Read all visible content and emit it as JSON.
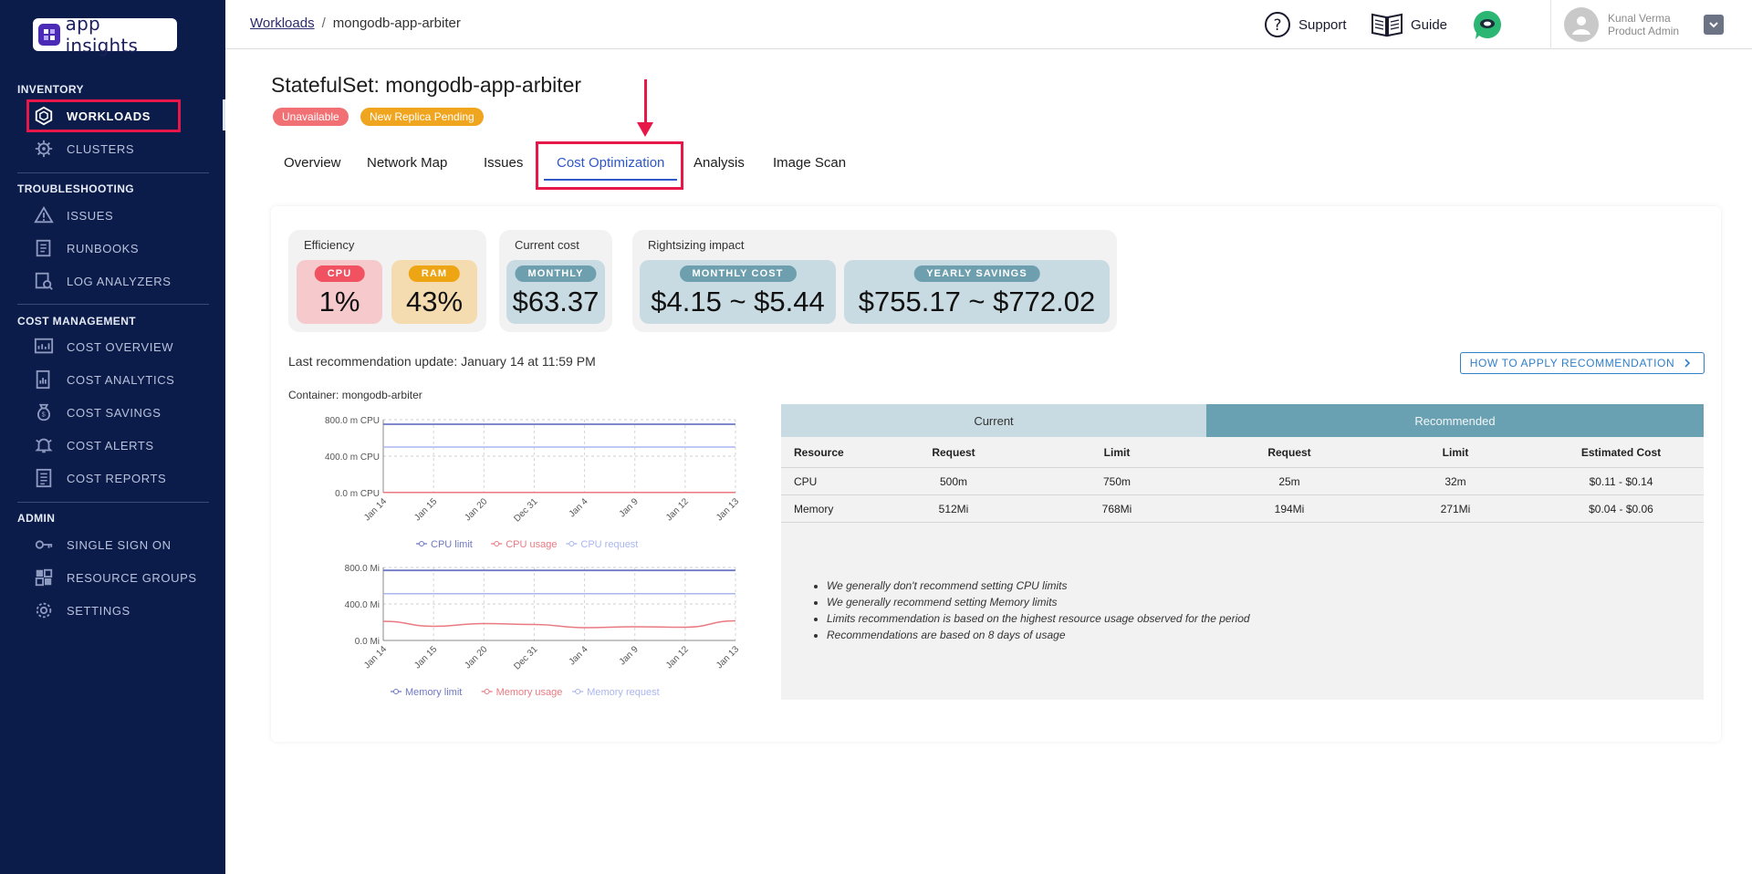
{
  "app": {
    "logo_text": "app insights"
  },
  "sidebar": {
    "sections": [
      {
        "label": "INVENTORY",
        "items": [
          {
            "label": "WORKLOADS",
            "icon": "cube-icon",
            "active": true
          },
          {
            "label": "CLUSTERS",
            "icon": "helm-icon"
          }
        ]
      },
      {
        "label": "TROUBLESHOOTING",
        "items": [
          {
            "label": "ISSUES",
            "icon": "warning-icon"
          },
          {
            "label": "RUNBOOKS",
            "icon": "book-icon"
          },
          {
            "label": "LOG ANALYZERS",
            "icon": "log-icon"
          }
        ]
      },
      {
        "label": "COST MANAGEMENT",
        "items": [
          {
            "label": "COST OVERVIEW",
            "icon": "dashboard-icon"
          },
          {
            "label": "COST ANALYTICS",
            "icon": "analytics-icon"
          },
          {
            "label": "COST SAVINGS",
            "icon": "money-bag-icon"
          },
          {
            "label": "COST ALERTS",
            "icon": "alert-icon"
          },
          {
            "label": "COST REPORTS",
            "icon": "report-icon"
          }
        ]
      },
      {
        "label": "ADMIN",
        "items": [
          {
            "label": "SINGLE SIGN ON",
            "icon": "key-icon"
          },
          {
            "label": "RESOURCE GROUPS",
            "icon": "grid-icon"
          },
          {
            "label": "SETTINGS",
            "icon": "gear-icon"
          }
        ]
      }
    ]
  },
  "topbar": {
    "breadcrumb_root": "Workloads",
    "breadcrumb_sep": "/",
    "breadcrumb_current": "mongodb-app-arbiter",
    "support": "Support",
    "guide": "Guide",
    "user_name": "Kunal Verma",
    "user_role": "Product Admin"
  },
  "page": {
    "title": "StatefulSet: mongodb-app-arbiter",
    "badges": [
      "Unavailable",
      "New Replica Pending"
    ],
    "tabs": [
      "Overview",
      "Network Map",
      "Issues",
      "Cost Optimization",
      "Analysis",
      "Image Scan"
    ],
    "active_tab": "Cost Optimization"
  },
  "efficiency": {
    "label": "Efficiency",
    "cpu_label": "CPU",
    "cpu_value": "1%",
    "ram_label": "RAM",
    "ram_value": "43%"
  },
  "current_cost": {
    "label": "Current cost",
    "pill": "MONTHLY",
    "value": "$63.37"
  },
  "rightsizing": {
    "label": "Rightsizing impact",
    "monthly_pill": "MONTHLY COST",
    "monthly_value": "$4.15 ~ $5.44",
    "yearly_pill": "YEARLY SAVINGS",
    "yearly_value": "$755.17 ~ $772.02"
  },
  "recommendation": {
    "last_update": "Last recommendation update: January 14 at 11:59 PM",
    "how_button": "HOW TO APPLY RECOMMENDATION",
    "container_label": "Container: mongodb-arbiter"
  },
  "table": {
    "group_current": "Current",
    "group_recommended": "Recommended",
    "columns": [
      "Resource",
      "Request",
      "Limit",
      "Request",
      "Limit",
      "Estimated Cost"
    ],
    "rows": [
      [
        "CPU",
        "500m",
        "750m",
        "25m",
        "32m",
        "$0.11 - $0.14"
      ],
      [
        "Memory",
        "512Mi",
        "768Mi",
        "194Mi",
        "271Mi",
        "$0.04 - $0.06"
      ]
    ],
    "notes": [
      "We generally don't recommend setting CPU limits",
      "We generally recommend setting Memory limits",
      "Limits recommendation is based on the highest resource usage observed for the period",
      "Recommendations are based on 8 days of usage"
    ]
  },
  "colors": {
    "limit": "#6f78c4",
    "usage": "#e97a82",
    "request": "#aab6ee",
    "highlight": "#e8174a",
    "sidebar": "#0c1c4a"
  },
  "chart_data": [
    {
      "type": "line",
      "x": [
        "Jan 14",
        "Jan 15",
        "Jan 20",
        "Dec 31",
        "Jan 4",
        "Jan 9",
        "Jan 12",
        "Jan 13"
      ],
      "ylim": [
        0,
        800
      ],
      "yticks": [
        "0.0 m CPU",
        "400.0 m CPU",
        "800.0 m CPU"
      ],
      "series": [
        {
          "name": "CPU limit",
          "values": [
            750,
            750,
            750,
            750,
            750,
            750,
            750,
            750
          ]
        },
        {
          "name": "CPU usage",
          "values": [
            3,
            3,
            3,
            3,
            3,
            3,
            3,
            3
          ]
        },
        {
          "name": "CPU request",
          "values": [
            500,
            500,
            500,
            500,
            500,
            500,
            500,
            500
          ]
        }
      ]
    },
    {
      "type": "line",
      "x": [
        "Jan 14",
        "Jan 15",
        "Jan 20",
        "Dec 31",
        "Jan 4",
        "Jan 9",
        "Jan 12",
        "Jan 13"
      ],
      "ylim": [
        0,
        800
      ],
      "yticks": [
        "0.0 Mi",
        "400.0 Mi",
        "800.0 Mi"
      ],
      "series": [
        {
          "name": "Memory limit",
          "values": [
            768,
            768,
            768,
            768,
            768,
            768,
            768,
            768
          ]
        },
        {
          "name": "Memory usage",
          "values": [
            210,
            155,
            185,
            175,
            140,
            150,
            145,
            215
          ]
        },
        {
          "name": "Memory request",
          "values": [
            512,
            512,
            512,
            512,
            512,
            512,
            512,
            512
          ]
        }
      ]
    }
  ]
}
